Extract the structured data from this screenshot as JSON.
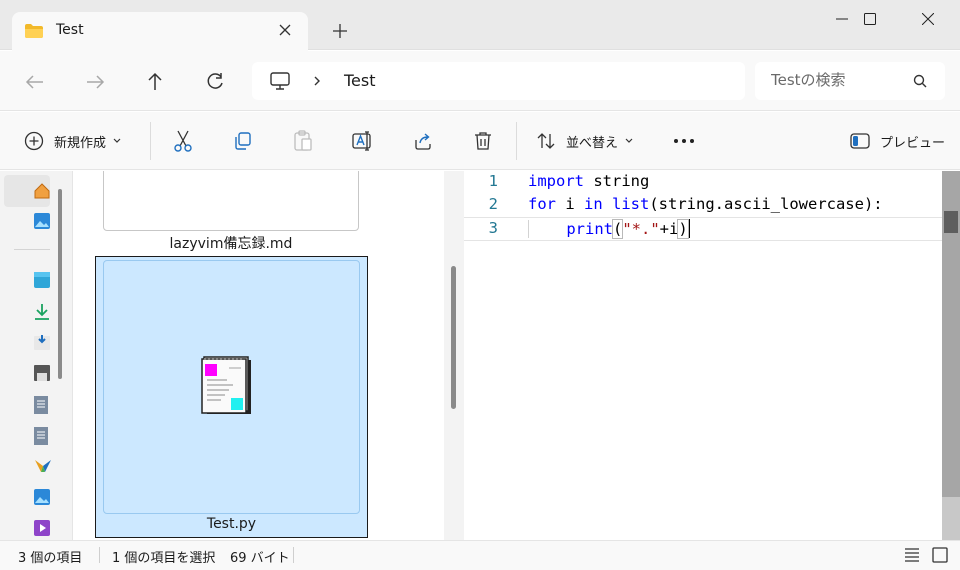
{
  "window": {
    "tab_title": "Test",
    "icons": {
      "tab": "folder-icon",
      "close_tab": "close-icon",
      "new_tab": "plus-icon"
    }
  },
  "address": {
    "breadcrumb": [
      "Test"
    ],
    "search_placeholder": "Testの検索"
  },
  "toolbar": {
    "new_label": "新規作成",
    "sort_label": "並べ替え",
    "preview_label": "プレビュー"
  },
  "nav": {
    "icons": [
      "home-icon",
      "gallery-icon",
      "desktop-icon",
      "downloads-icon",
      "documents-icon",
      "drive-icon",
      "file-icon",
      "file-icon",
      "app-icon",
      "pictures-icon",
      "videos-icon"
    ]
  },
  "files": {
    "items": [
      {
        "name": "lazyvim備忘録.md",
        "selected": false
      },
      {
        "name": "Test.py",
        "selected": true
      }
    ]
  },
  "preview": {
    "lines": [
      {
        "num": "1",
        "tokens": [
          "import",
          " string"
        ]
      },
      {
        "num": "2",
        "tokens": [
          "for",
          " i ",
          "in",
          " list",
          "(string.ascii_lowercase):"
        ]
      },
      {
        "num": "3",
        "tokens": [
          "print",
          "(",
          "\"*.\"",
          "+i",
          ")"
        ]
      }
    ]
  },
  "status": {
    "item_count": "3 個の項目",
    "selection": "1 個の項目を選択",
    "size": "69 バイト"
  },
  "colors": {
    "selection_bg": "#cce8ff",
    "keyword": "#0000ff",
    "string": "#a31515",
    "line_number": "#237893"
  }
}
